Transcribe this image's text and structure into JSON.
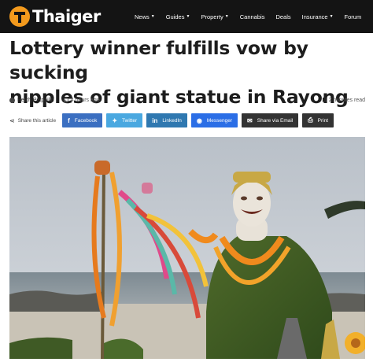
{
  "header": {
    "logo_text": "Thaiger",
    "nav": [
      {
        "label": "News",
        "dropdown": true
      },
      {
        "label": "Guides",
        "dropdown": true
      },
      {
        "label": "Property",
        "dropdown": true
      },
      {
        "label": "Cannabis",
        "dropdown": false
      },
      {
        "label": "Deals",
        "dropdown": false
      },
      {
        "label": "Insurance",
        "dropdown": true
      },
      {
        "label": "Forum",
        "dropdown": false
      }
    ],
    "colors": {
      "bar": "#141414",
      "brand": "#f39a1d"
    }
  },
  "article": {
    "headline_line1": "Lottery winner fulfills vow by sucking",
    "headline_line2": "nipples of giant statue in Rayong",
    "author": "Petch Petpailin",
    "time_ago": "4 hours ago",
    "read_time": "2 minutes read"
  },
  "share": {
    "label": "Share this article",
    "buttons": [
      {
        "label": "Facebook",
        "icon": "facebook-icon",
        "color": "#3b6fc1"
      },
      {
        "label": "Twitter",
        "icon": "twitter-icon",
        "color": "#4aa8e0"
      },
      {
        "label": "LinkedIn",
        "icon": "linkedin-icon",
        "color": "#2f78b0"
      },
      {
        "label": "Messenger",
        "icon": "messenger-icon",
        "color": "#2b6ee6"
      },
      {
        "label": "Share via Email",
        "icon": "email-icon",
        "color": "#333333"
      },
      {
        "label": "Print",
        "icon": "print-icon",
        "color": "#333333"
      }
    ]
  }
}
